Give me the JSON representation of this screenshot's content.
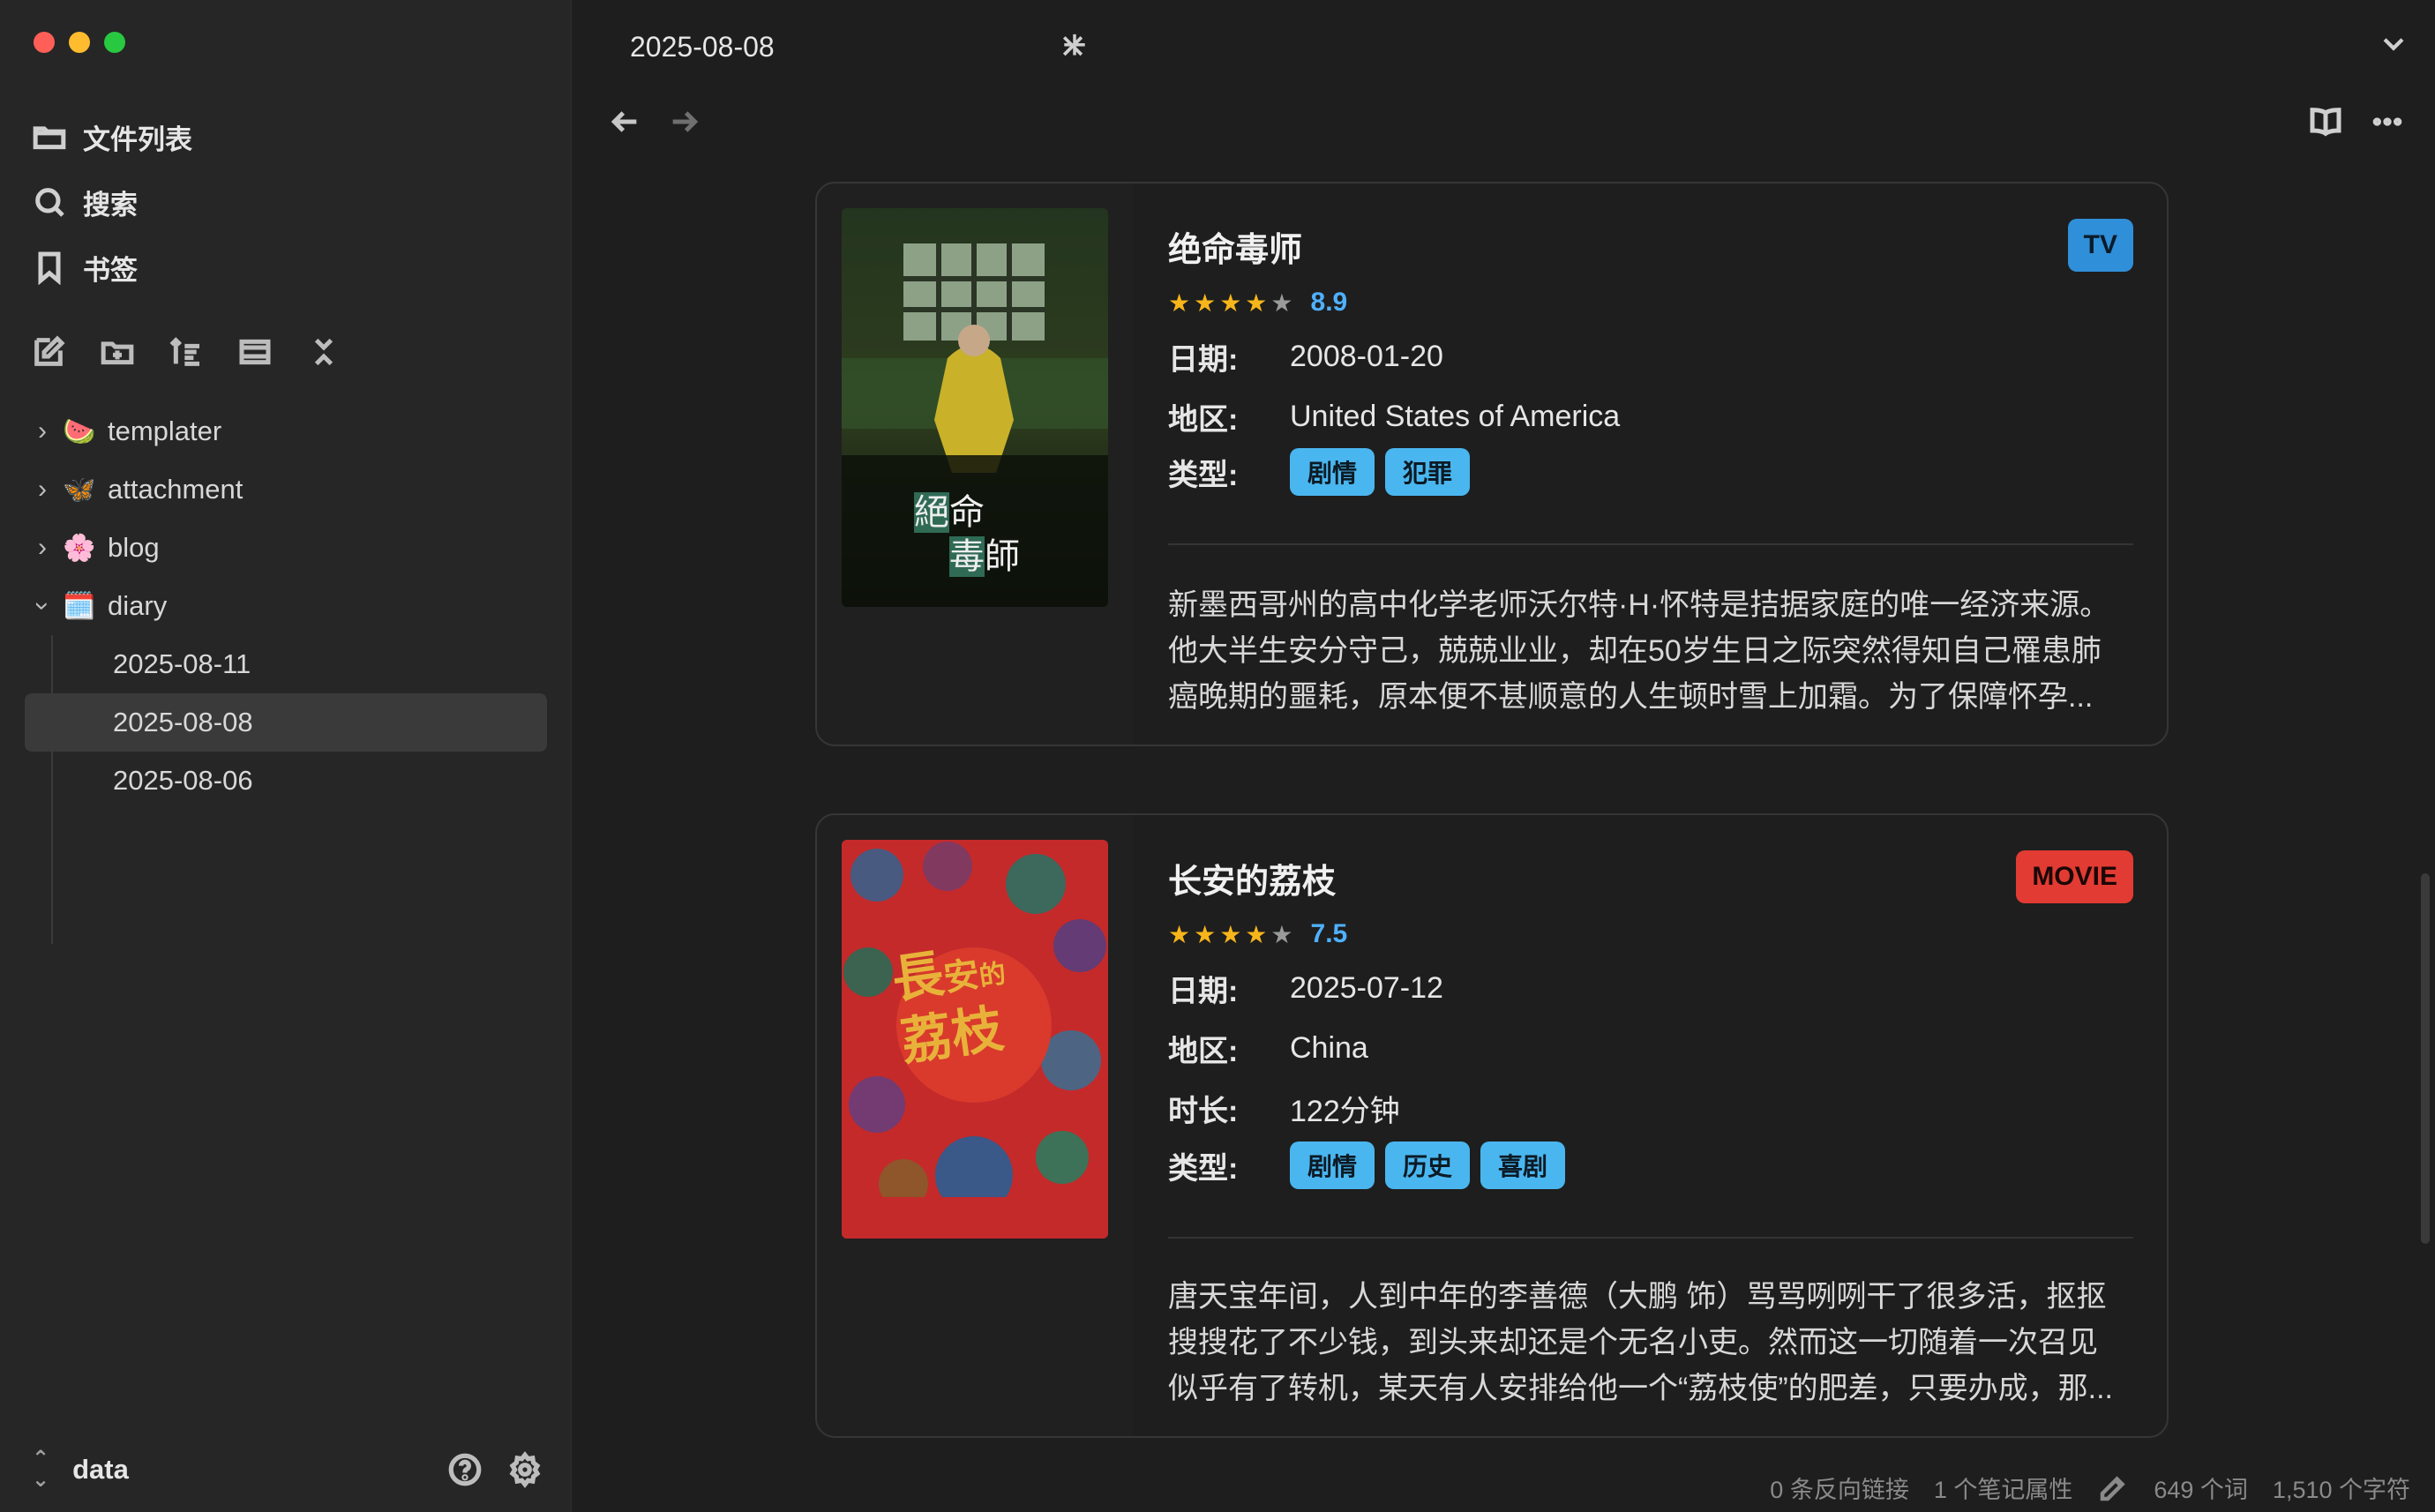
{
  "sidebar": {
    "nav": [
      {
        "label": "文件列表",
        "icon": "folder-icon"
      },
      {
        "label": "搜索",
        "icon": "search-icon"
      },
      {
        "label": "书签",
        "icon": "bookmark-icon"
      }
    ],
    "toolbar_icons": [
      "new-note-icon",
      "new-folder-icon",
      "sort-icon",
      "collapse-view-icon",
      "collapse-all-icon"
    ],
    "tree": [
      {
        "label": "templater",
        "emoji": "🍉",
        "expanded": false
      },
      {
        "label": "attachment",
        "emoji": "🦋",
        "expanded": false
      },
      {
        "label": "blog",
        "emoji": "🌸",
        "expanded": false
      },
      {
        "label": "diary",
        "emoji": "🗓️",
        "expanded": true
      }
    ],
    "diary_children": [
      "2025-08-11",
      "2025-08-08",
      "2025-08-06"
    ],
    "active_child": "2025-08-08",
    "vault_name": "data"
  },
  "tab": {
    "title": "2025-08-08"
  },
  "cards": [
    {
      "title": "绝命毒师",
      "badge": "TV",
      "rating": "8.9",
      "date_label": "日期:",
      "date": "2008-01-20",
      "region_label": "地区:",
      "region": "United States of America",
      "genre_label": "类型:",
      "genres": [
        "剧情",
        "犯罪"
      ],
      "poster_text": [
        "絕",
        "命",
        "毒",
        "師"
      ],
      "description": [
        "新墨西哥州的高中化学老师沃尔特·H·怀特是拮据家庭的唯一经济来源。",
        "他大半生安分守己，兢兢业业，却在50岁生日之际突然得知自己罹患肺",
        "癌晚期的噩耗，原本便不甚顺意的人生顿时雪上加霜。为了保障怀孕..."
      ]
    },
    {
      "title": "长安的荔枝",
      "badge": "MOVIE",
      "rating": "7.5",
      "date_label": "日期:",
      "date": "2025-07-12",
      "region_label": "地区:",
      "region": "China",
      "duration_label": "时长:",
      "duration": "122分钟",
      "genre_label": "类型:",
      "genres": [
        "剧情",
        "历史",
        "喜剧"
      ],
      "poster_text": [
        "長",
        "安",
        "的",
        "荔",
        "枝"
      ],
      "description": [
        "唐天宝年间，人到中年的李善德（大鹏 饰）骂骂咧咧干了很多活，抠抠",
        "搜搜花了不少钱，到头来却还是个无名小吏。然而这一切随着一次召见",
        "似乎有了转机，某天有人安排给他一个“荔枝使”的肥差，只要办成，那..."
      ]
    }
  ],
  "status": {
    "backlinks": "0 条反向链接",
    "properties": "1 个笔记属性",
    "words": "649 个词",
    "chars": "1,510 个字符"
  },
  "colors": {
    "tv_badge": "#2f8fd8",
    "movie_badge": "#e23b33",
    "tag": "#4ab6ef",
    "score": "#4fb0ff",
    "star": "#f6b51a"
  }
}
